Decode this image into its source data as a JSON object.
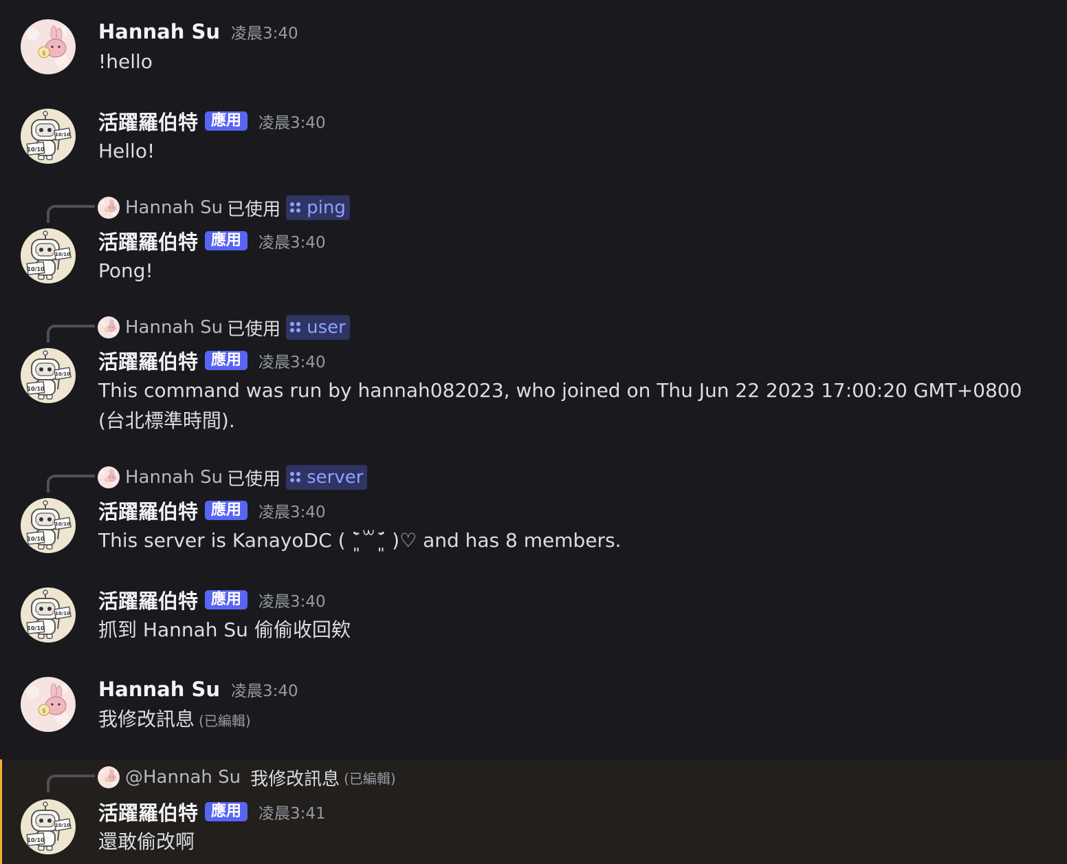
{
  "messages": [
    {
      "author": "Hannah Su",
      "avatar": "kanahei-rabbit-avatar",
      "timestamp": "凌晨3:40",
      "content": "!hello"
    },
    {
      "author": "活躍羅伯特",
      "avatar": "robot-avatar",
      "badge": "應用",
      "timestamp": "凌晨3:40",
      "content": "Hello!"
    },
    {
      "reply": {
        "user": "Hannah Su",
        "used": "已使用",
        "command": "ping"
      },
      "author": "活躍羅伯特",
      "badge": "應用",
      "timestamp": "凌晨3:40",
      "content": "Pong!"
    },
    {
      "reply": {
        "user": "Hannah Su",
        "used": "已使用",
        "command": "user"
      },
      "author": "活躍羅伯特",
      "badge": "應用",
      "timestamp": "凌晨3:40",
      "content": "This command was run by hannah082023, who joined on Thu Jun 22 2023 17:00:20 GMT+0800 (台北標準時間)."
    },
    {
      "reply": {
        "user": "Hannah Su",
        "used": "已使用",
        "command": "server"
      },
      "author": "活躍羅伯特",
      "badge": "應用",
      "timestamp": "凌晨3:40",
      "content": "This server is KanayoDC ( ˉ͈̀꒳ˉ͈́ )♡ and has 8 members."
    },
    {
      "author": "活躍羅伯特",
      "badge": "應用",
      "timestamp": "凌晨3:40",
      "content": "抓到 Hannah Su 偷偷收回欸"
    },
    {
      "author": "Hannah Su",
      "timestamp": "凌晨3:40",
      "content": "我修改訊息",
      "edited": "(已編輯)"
    },
    {
      "reply": {
        "user": "@Hannah Su",
        "text": "我修改訊息",
        "edited": "(已編輯)"
      },
      "author": "活躍羅伯特",
      "badge": "應用",
      "timestamp": "凌晨3:41",
      "content": "還敢偷改啊"
    }
  ],
  "colors": {
    "background": "#1a1a1e",
    "badge": "#5865f2",
    "command_chip": "#2f3462",
    "command_text": "#8ea1ff",
    "highlight_bg": "#221f1c",
    "highlight_bar": "#f0b132"
  }
}
